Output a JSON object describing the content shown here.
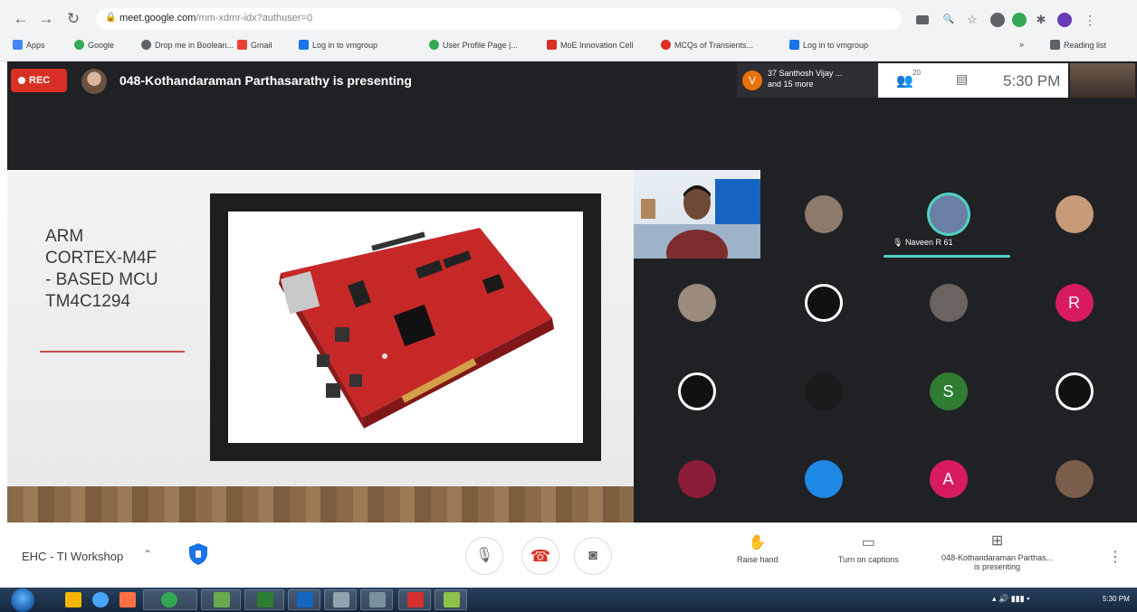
{
  "browser": {
    "url_host": "meet.google.com",
    "url_path": "/mm-xdmr-idx?authuser=0",
    "back_icon": "arrow-left-icon",
    "forward_icon": "arrow-right-icon",
    "reload_icon": "reload-icon",
    "bookmarks": [
      {
        "label": "Apps",
        "color": "#4285f4"
      },
      {
        "label": "Google",
        "color": "#34a853"
      },
      {
        "label": "Drop me in Boolean...",
        "color": "#5f6368"
      },
      {
        "label": "Gmail",
        "color": "#ea4335"
      },
      {
        "label": "Log in to vmgroup",
        "color": "#1a73e8"
      },
      {
        "label": "User Profile Page |...",
        "color": "#34a853"
      },
      {
        "label": "MoE Innovation Cell",
        "color": "#d93025"
      },
      {
        "label": "MCQs of Transients...",
        "color": "#d93025"
      },
      {
        "label": "Log in to vmgroup",
        "color": "#1a73e8"
      }
    ],
    "reading_list": "Reading list"
  },
  "meet": {
    "rec_label": "REC",
    "presenting_text": "048-Kothandaraman Parthasarathy is presenting",
    "speaker_initial": "V",
    "speaker_line1": "37 Santhosh Vijay ...",
    "speaker_line2": "and 15 more",
    "people_count": "20",
    "clock": "5:30 PM",
    "speaking_name": "Naveen R 61"
  },
  "slide": {
    "title_lines": [
      "ARM",
      "CORTEX-M4F",
      "- BASED MCU",
      "TM4C1294"
    ]
  },
  "participants": [
    {
      "initial": "",
      "color": "#8d7a6b"
    },
    {
      "initial": "",
      "color": "#6b7ea3"
    },
    {
      "initial": "",
      "color": "#c79a7a"
    },
    {
      "initial": "",
      "color": "#9a8b7d"
    },
    {
      "initial": "",
      "color": "#111111"
    },
    {
      "initial": "",
      "color": "#6b6360"
    },
    {
      "initial": "R",
      "color": "#d81b60"
    },
    {
      "initial": "",
      "color": "#111111"
    },
    {
      "initial": "",
      "color": "#1a1a1a"
    },
    {
      "initial": "S",
      "color": "#2e7d32"
    },
    {
      "initial": "",
      "color": "#111111"
    },
    {
      "initial": "",
      "color": "#8b1c3a"
    },
    {
      "initial": "",
      "color": "#1e88e5"
    },
    {
      "initial": "A",
      "color": "#d81b60"
    },
    {
      "initial": "",
      "color": "#7a5d4a"
    }
  ],
  "controls": {
    "meeting_name": "EHC - TI Workshop",
    "raise_hand": "Raise hand",
    "captions": "Turn on captions",
    "presenting_line1": "048-Kothandaraman Parthas...",
    "presenting_line2": "is presenting"
  },
  "taskbar": {
    "time": "5:30 PM"
  },
  "colors": {
    "rec": "#d93025",
    "leave_call": "#d93025",
    "speaking_bar": "#4fd1c5",
    "meet_bg": "#202124"
  }
}
